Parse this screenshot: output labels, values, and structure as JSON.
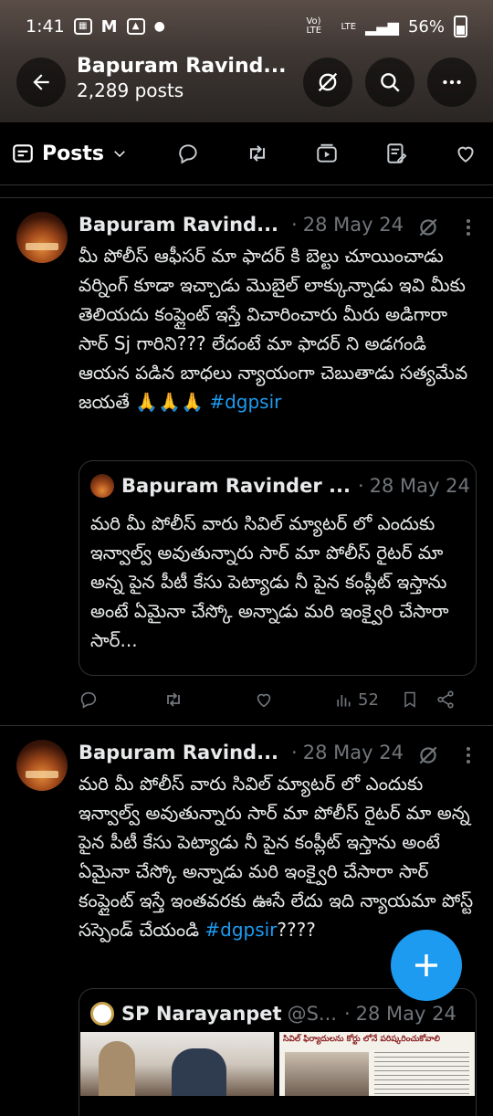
{
  "status_bar": {
    "time": "1:41",
    "network": "Vo) LTE",
    "battery": "56%"
  },
  "header": {
    "title": "Bapuram Ravind...",
    "posts_count": "2,289 posts"
  },
  "tabs": {
    "posts_label": "Posts"
  },
  "posts": [
    {
      "author": "Bapuram Ravind...",
      "date": "28 May 24",
      "text": "మీ పోలీస్ ఆఫీసర్ మా ఫాదర్ కి బెల్టు చూయించాడు  వర్నింగ్ కూడా ఇచ్చాడు మొబైల్ లాక్కున్నాడు ఇవి మీకు తెలియదు కంప్లైంట్ ఇస్తే విచారించారు మీరు అడిగారా సార్ Sj గారిని??? లేదంటే మా ఫాదర్ ని అడగండి  ఆయన పడిన బాధలు   న్యాయంగా చెబుతాడు సత్యమేవ జయతే 🙏🙏🙏",
      "hashtag": "#dgpsir",
      "quote": {
        "author": "Bapuram Ravinder ...",
        "date": "28 May 24",
        "text": "మరి మీ పోలీస్ వారు సివిల్ మ్యాటర్ లో ఎందుకు ఇన్వాల్వ్  అవుతున్నారు సార్ మా పోలీస్  రైటర్  మా అన్న పైన పీటీ కేసు పెట్యాడు నీ పైన కంప్లీట్ ఇస్తాను అంటే ఏమైనా చేస్కో అన్నాడు మరి ఇంక్వైరి చేసారా  సార్..."
      },
      "views": "52"
    },
    {
      "author": "Bapuram Ravind...",
      "date": "28 May 24",
      "text": "మరి మీ పోలీస్ వారు సివిల్ మ్యాటర్ లో ఎందుకు ఇన్వాల్వ్  అవుతున్నారు సార్ మా పోలీస్  రైటర్  మా అన్న పైన పీటీ కేసు పెట్యాడు నీ పైన కంప్లీట్ ఇస్తాను అంటే ఏమైనా చేస్కో అన్నాడు మరి ఇంక్వైరి చేసారా  సార్ కంప్లైంట్ ఇస్తే ఇంతవరకు ఊసే లేదు ఇది  న్యాయమా పోస్ట్ సస్పెండ్ చేయండి",
      "hashtag": "#dgpsir",
      "suffix": "????",
      "quote": {
        "author": "SP Narayanpet",
        "handle": "@S...",
        "date": "28 May 24",
        "media_caption": "సివిల్ ఫిర్యాదులను కోర్టు లోనే పరిష్కరించుకోవాలి"
      }
    }
  ],
  "icons": {
    "back": "arrow-left-icon",
    "notify_off": "notifications-off-icon",
    "search": "search-icon",
    "more": "more-horizontal-icon",
    "compose": "plus-icon"
  },
  "colors": {
    "accent": "#1d9bf0",
    "muted": "#71767b",
    "text": "#e7e9ea",
    "border": "#2f3336"
  }
}
